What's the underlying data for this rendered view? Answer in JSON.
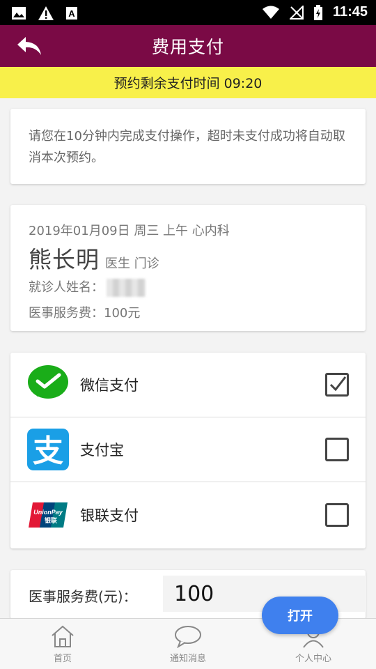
{
  "status_bar": {
    "time": "11:45",
    "left_icons": [
      "image-icon",
      "warning-icon",
      "a-box-icon"
    ],
    "right_icons": [
      "wifi-icon",
      "no-signal-icon",
      "battery-charging-icon"
    ]
  },
  "app_bar": {
    "title": "费用支付",
    "back_icon": "back-arrow-icon",
    "color": "#7a0a45"
  },
  "banner": {
    "text": "预约剩余支付时间 09:20",
    "color": "#f8f04a"
  },
  "notice": {
    "text": "请您在10分钟内完成支付操作，超时未支付成功将自动取消本次预约。"
  },
  "appointment": {
    "date_line": "2019年01月09日 周三 上午 心内科",
    "doctor_name": "熊长明",
    "doctor_title": "医生 门诊",
    "patient_label": "就诊人姓名：",
    "fee_line": "医事服务费：100元"
  },
  "payment_methods": [
    {
      "label": "微信支付",
      "icon": "wechat-pay-icon",
      "checked": true
    },
    {
      "label": "支付宝",
      "icon": "alipay-icon",
      "checked": false
    },
    {
      "label": "银联支付",
      "icon": "unionpay-icon",
      "checked": false
    }
  ],
  "unionpay_logo": {
    "top": "UnionPay",
    "bottom": "银联"
  },
  "fee_input": {
    "label": "医事服务费(元)：",
    "value": "100"
  },
  "floating_button": {
    "label": "打开"
  },
  "bottom_nav": [
    {
      "label": "首页",
      "icon": "home-icon"
    },
    {
      "label": "通知消息",
      "icon": "chat-bubble-icon"
    },
    {
      "label": "个人中心",
      "icon": "person-icon"
    }
  ]
}
